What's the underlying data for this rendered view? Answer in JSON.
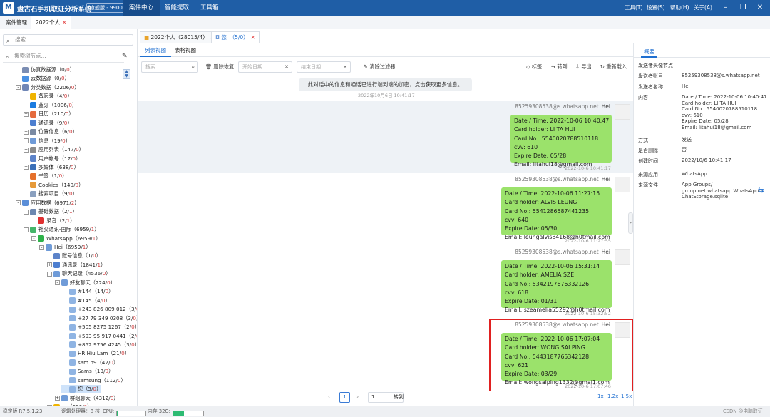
{
  "app": {
    "title": "盘古石手机取证分析系统",
    "version": "旗舰版 - 9900",
    "menus": [
      "案件中心",
      "智能提取",
      "工具箱"
    ],
    "right_menus": [
      "工具(T)",
      "设置(S)",
      "帮助(H)",
      "关于(A)"
    ]
  },
  "tabbar": {
    "items": [
      "案件管理",
      "2022个人"
    ]
  },
  "left": {
    "search_placeholder": "搜索...",
    "tree_search_placeholder": "搜索树节点...",
    "tree": [
      {
        "label": "仿真数据源",
        "count": "0",
        "red": "0",
        "indent": 1,
        "color": "#7b8db3"
      },
      {
        "label": "云数据源",
        "count": "0",
        "red": "0",
        "indent": 1,
        "color": "#4a90e2"
      },
      {
        "label": "分类数据",
        "count": "2206",
        "red": "0",
        "indent": 1,
        "color": "#6f86b6",
        "exp": "-"
      },
      {
        "label": "备忘录",
        "count": "4",
        "red": "0",
        "indent": 2,
        "color": "#f0b400"
      },
      {
        "label": "蓝牙",
        "count": "1006",
        "red": "0",
        "indent": 2,
        "color": "#1b7be0"
      },
      {
        "label": "日历",
        "count": "210",
        "red": "0",
        "indent": 2,
        "color": "#e56b3d",
        "exp": "+"
      },
      {
        "label": "通讯录",
        "count": "9",
        "red": "0",
        "indent": 2,
        "color": "#4d7fd0"
      },
      {
        "label": "位置信息",
        "count": "6",
        "red": "0",
        "indent": 2,
        "color": "#7a8aa3",
        "exp": "+"
      },
      {
        "label": "信息",
        "count": "19",
        "red": "0",
        "indent": 2,
        "color": "#6f9bd8",
        "exp": "+"
      },
      {
        "label": "应用列表",
        "count": "147",
        "red": "0",
        "indent": 2,
        "color": "#8b8b8b",
        "exp": "+"
      },
      {
        "label": "用户帐号",
        "count": "17",
        "red": "0",
        "indent": 2,
        "color": "#5c83c9"
      },
      {
        "label": "多媒体",
        "count": "638",
        "red": "0",
        "indent": 2,
        "color": "#3a6fb8",
        "exp": "+"
      },
      {
        "label": "书签",
        "count": "1",
        "red": "0",
        "indent": 2,
        "color": "#e5702b"
      },
      {
        "label": "Cookies",
        "count": "140",
        "red": "0",
        "indent": 2,
        "color": "#e69a3a"
      },
      {
        "label": "搜索项目",
        "count": "9",
        "red": "0",
        "indent": 2,
        "color": "#8aa0bf"
      },
      {
        "label": "应用数据",
        "count": "6971",
        "red": "2",
        "indent": 1,
        "color": "#5b8ed8",
        "exp": "-"
      },
      {
        "label": "基础数据",
        "count": "2",
        "red": "1",
        "indent": 2,
        "color": "#6d88b0",
        "exp": "-"
      },
      {
        "label": "录音",
        "count": "2",
        "red": "1",
        "indent": 3,
        "color": "#e03030"
      },
      {
        "label": "社交通讯-国际",
        "count": "6959",
        "red": "1",
        "indent": 2,
        "color": "#45b56a",
        "exp": "-"
      },
      {
        "label": "WhatsApp",
        "count": "6959",
        "red": "1",
        "indent": 3,
        "color": "#2fb24a",
        "exp": "-"
      },
      {
        "label": "Hei",
        "count": "6959",
        "red": "1",
        "indent": 4,
        "color": "#6f9bd8",
        "exp": "-"
      },
      {
        "label": "账号信息",
        "count": "1",
        "red": "0",
        "indent": 5,
        "color": "#5c83c9"
      },
      {
        "label": "通讯录",
        "count": "1841",
        "red": "1",
        "indent": 5,
        "color": "#4d7fd0",
        "exp": "+"
      },
      {
        "label": "聊天记录",
        "count": "4536",
        "red": "0",
        "indent": 5,
        "color": "#6f9bd8",
        "exp": "-"
      },
      {
        "label": "好友聊天",
        "count": "224",
        "red": "0",
        "indent": 6,
        "color": "#6f9bd8",
        "exp": "-"
      },
      {
        "label": "#144",
        "count": "14",
        "red": "0",
        "indent": 7,
        "color": "#8fb4e3"
      },
      {
        "label": "#145",
        "count": "4",
        "red": "0",
        "indent": 7,
        "color": "#8fb4e3"
      },
      {
        "label": "+243 826 809 012",
        "count": "3",
        "red": "0",
        "indent": 7,
        "color": "#8fb4e3"
      },
      {
        "label": "+27 79 349 0308",
        "count": "3",
        "red": "0",
        "indent": 7,
        "color": "#8fb4e3"
      },
      {
        "label": "+505 8275 1267",
        "count": "2",
        "red": "0",
        "indent": 7,
        "color": "#8fb4e3"
      },
      {
        "label": "+593 95 917 0441",
        "count": "2",
        "red": "0",
        "indent": 7,
        "color": "#8fb4e3"
      },
      {
        "label": "+852 9756 4245",
        "count": "3",
        "red": "0",
        "indent": 7,
        "color": "#8fb4e3"
      },
      {
        "label": "HR Hiu Lam",
        "count": "21",
        "red": "0",
        "indent": 7,
        "color": "#8fb4e3"
      },
      {
        "label": "sam n9",
        "count": "42",
        "red": "0",
        "indent": 7,
        "color": "#8fb4e3"
      },
      {
        "label": "Sams",
        "count": "13",
        "red": "0",
        "indent": 7,
        "color": "#8fb4e3"
      },
      {
        "label": "samsung",
        "count": "112",
        "red": "0",
        "indent": 7,
        "color": "#8fb4e3"
      },
      {
        "label": "您",
        "count": "5",
        "red": "0",
        "indent": 7,
        "color": "#8fb4e3",
        "sel": true
      },
      {
        "label": "群组聊天",
        "count": "4312",
        "red": "0",
        "indent": 6,
        "color": "#6f9bd8",
        "exp": "+"
      },
      {
        "label": "…",
        "count": "696",
        "red": "0",
        "indent": 5,
        "color": "#f0b400",
        "exp": "+"
      }
    ]
  },
  "main": {
    "tabs": [
      {
        "label": "2022个人（28015/4）"
      },
      {
        "label": "您　（5/0）"
      }
    ],
    "view_tabs": [
      "列表视图",
      "表格视图"
    ],
    "filter": {
      "search_placeholder": "搜索...",
      "delete_restore": "删除恢复",
      "start_date": "开始日期",
      "end_date": "结束日期",
      "clear_filter": "清除过滤器",
      "tag": "标签",
      "forward": "转到",
      "export": "导出",
      "reload": "重新载入"
    },
    "notice": "此对话中的信息和通话已进行端到端的加密，点击获取更多信息。",
    "notice_time": "2022年10月6日 10:41:17",
    "messages": [
      {
        "sender": "85259308538@s.whatsapp.net",
        "name": "Hei",
        "text": "Date / Time: 2022-10-06 10:40:47\nCard holder: LI TA HUI\nCard No.: 5540020788510118\ncvv: 610\nExpire Date: 05/28\nEmail: litahui18@gmail.com",
        "time": "2022-10-6 10:41:17"
      },
      {
        "sender": "85259308538@s.whatsapp.net",
        "name": "Hei",
        "text": "Date / Time: 2022-10-06 11:27:15\nCard holder: ALVIS LEUNG\nCard No.: 5541286587441235\ncvv: 640\nExpire Date: 05/30\nEmail: leungalvis84168@h0tmail.com",
        "time": "2022-10-6 11:27:55"
      },
      {
        "sender": "85259308538@s.whatsapp.net",
        "name": "Hei",
        "text": "Date / Time: 2022-10-06 15:31:14\nCard holder: AMELIA SZE\nCard No.: 5342197676332126\ncvv: 618\nExpire Date: 01/31\nEmail: szeamelia55292@h0tmail.com",
        "time": "2022-10-6 15:32:52"
      },
      {
        "sender": "85259308538@s.whatsapp.net",
        "name": "Hei",
        "text": "Date / Time: 2022-10-06 17:07:04\nCard holder: WONG SAI PING\nCard No.: 5443187765342128\ncvv: 621\nExpire Date: 03/29\nEmail: wongsaiping1332@gmai1.com",
        "time": "2022-10-6 17:07:46"
      }
    ],
    "pager": {
      "page": "1",
      "goto_value": "1",
      "goto_label": "转到",
      "zoom": [
        "1x",
        "1.2x",
        "1.5x"
      ]
    }
  },
  "right": {
    "tab": "概要",
    "rows": [
      {
        "label": "发送者头像节点",
        "value": ""
      },
      {
        "label": "发送者账号",
        "value": "85259308538@s.whatsapp.net"
      },
      {
        "label": "发送者名称",
        "value": "Hei"
      },
      {
        "label": "内容",
        "value": "Date / Time: 2022-10-06 10:40:47\nCard holder: LI TA HUI\nCard No.: 5540020788510118\ncvv: 610\nExpire Date: 05/28\nEmail: litahui18@gmail.com"
      },
      {
        "label": "方式",
        "value": "发送"
      },
      {
        "label": "是否删除",
        "value": "否"
      },
      {
        "label": "创建时间",
        "value": "2022/10/6 10:41:17"
      },
      {
        "label": "来源应用",
        "value": "WhatsApp"
      },
      {
        "label": "来源文件",
        "value": "App Groups/\ngroup.net.whatsapp.WhatsApp.s\nChatStorage.sqlite"
      }
    ]
  },
  "status": {
    "version": "稳定版 R7.5.1.23",
    "cpu_label": "逻辑处理器：8 核",
    "cpu_prefix": "CPU:",
    "mem_label": "内存 32G:",
    "mem_level": 0.35,
    "watermark": "CSDN @电脑取证"
  }
}
